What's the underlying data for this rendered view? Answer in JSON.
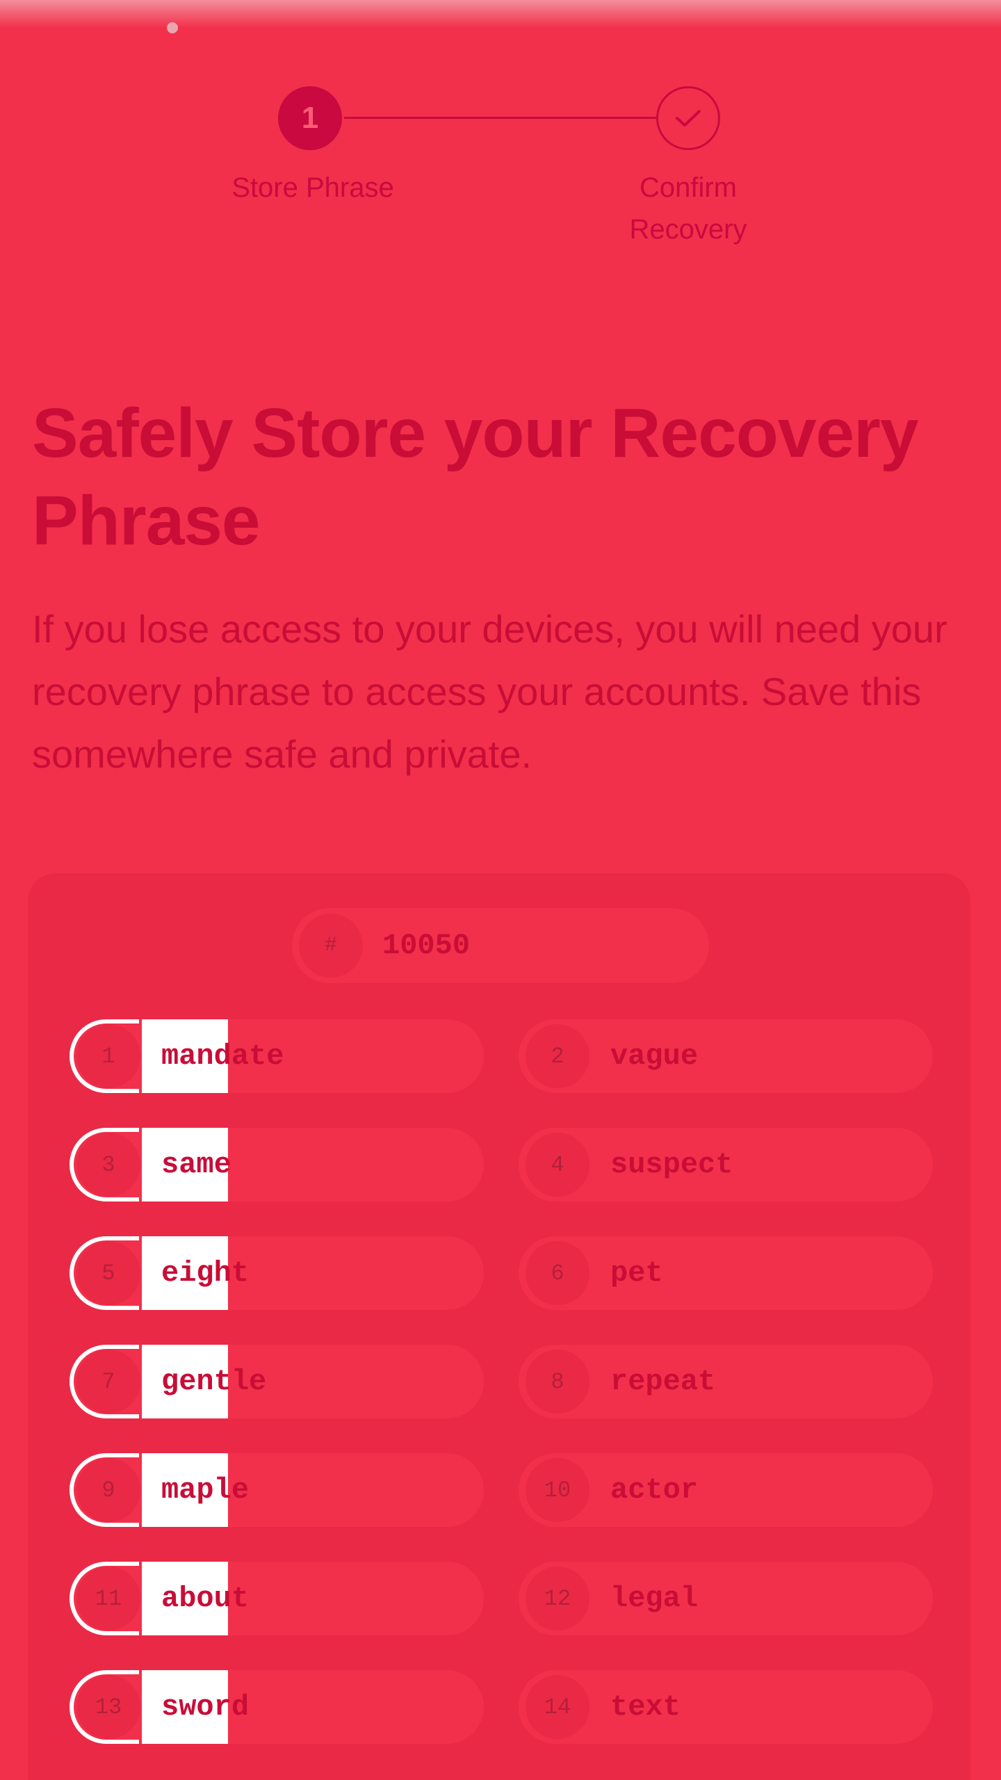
{
  "stepper": {
    "steps": [
      {
        "number": "1",
        "label": "Store Phrase",
        "state": "active"
      },
      {
        "label": "Confirm\nRecovery",
        "state": "pending",
        "icon": "check-icon"
      }
    ]
  },
  "heading": {
    "title": "Safely Store your Recovery Phrase",
    "description": "If you lose access to your devices, you will need your recovery phrase to access your accounts. Save this somewhere safe and private."
  },
  "card": {
    "index": {
      "symbol": "#",
      "value": "10050"
    },
    "words": [
      {
        "n": "1",
        "word": "mandate"
      },
      {
        "n": "2",
        "word": "vague"
      },
      {
        "n": "3",
        "word": "same"
      },
      {
        "n": "4",
        "word": "suspect"
      },
      {
        "n": "5",
        "word": "eight"
      },
      {
        "n": "6",
        "word": "pet"
      },
      {
        "n": "7",
        "word": "gentle"
      },
      {
        "n": "8",
        "word": "repeat"
      },
      {
        "n": "9",
        "word": "maple"
      },
      {
        "n": "10",
        "word": "actor"
      },
      {
        "n": "11",
        "word": "about"
      },
      {
        "n": "12",
        "word": "legal"
      },
      {
        "n": "13",
        "word": "sword"
      },
      {
        "n": "14",
        "word": "text"
      }
    ]
  },
  "colors": {
    "background": "#f2304b",
    "accent": "#c9093f",
    "card": "#ea2946"
  }
}
